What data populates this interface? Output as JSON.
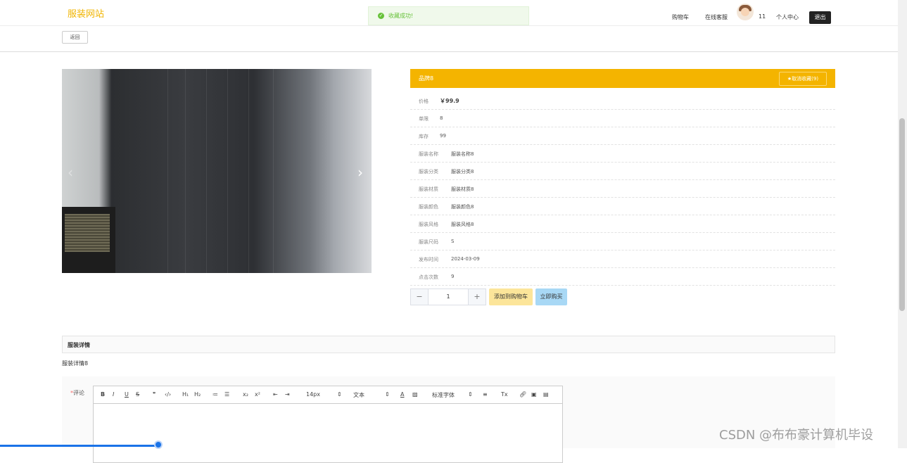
{
  "header": {
    "brand": "服装网站",
    "toast": "收藏成功!",
    "nav": {
      "cart": "购物车",
      "service": "在线客服",
      "user_id": "11",
      "center": "个人中心",
      "logout": "退出"
    }
  },
  "back_label": "返回",
  "product": {
    "title": "品牌8",
    "fav_label": "★取消收藏(9)",
    "rows": [
      {
        "key": "价格",
        "value": "￥99.9"
      },
      {
        "key": "单限",
        "value": "8"
      },
      {
        "key": "库存",
        "value": "99"
      },
      {
        "key": "服装名称",
        "value": "服装名称8"
      },
      {
        "key": "服装分类",
        "value": "服装分类8"
      },
      {
        "key": "服装材质",
        "value": "服装材质8"
      },
      {
        "key": "服装颜色",
        "value": "服装颜色8"
      },
      {
        "key": "服装风格",
        "value": "服装风格8"
      },
      {
        "key": "服装尺码",
        "value": "S"
      },
      {
        "key": "发布时间",
        "value": "2024-03-09"
      },
      {
        "key": "点击次数",
        "value": "9"
      }
    ],
    "quantity": "1",
    "add_cart": "添加到购物车",
    "buy_now": "立即购买"
  },
  "detail": {
    "title": "服装详情",
    "content": "服装详情8"
  },
  "comment": {
    "label": "评论",
    "required_mark": "*",
    "toolbar": {
      "font_size": "14px",
      "text_type": "文本",
      "font_family": "标准字体"
    }
  },
  "watermark": "CSDN @布布豪计算机毕设",
  "colors": {
    "brand": "#f0b400",
    "bar": "#f4b400",
    "cart_btn": "#fce59a",
    "buy_btn": "#a8d8f5",
    "toast": "#67c23a"
  }
}
